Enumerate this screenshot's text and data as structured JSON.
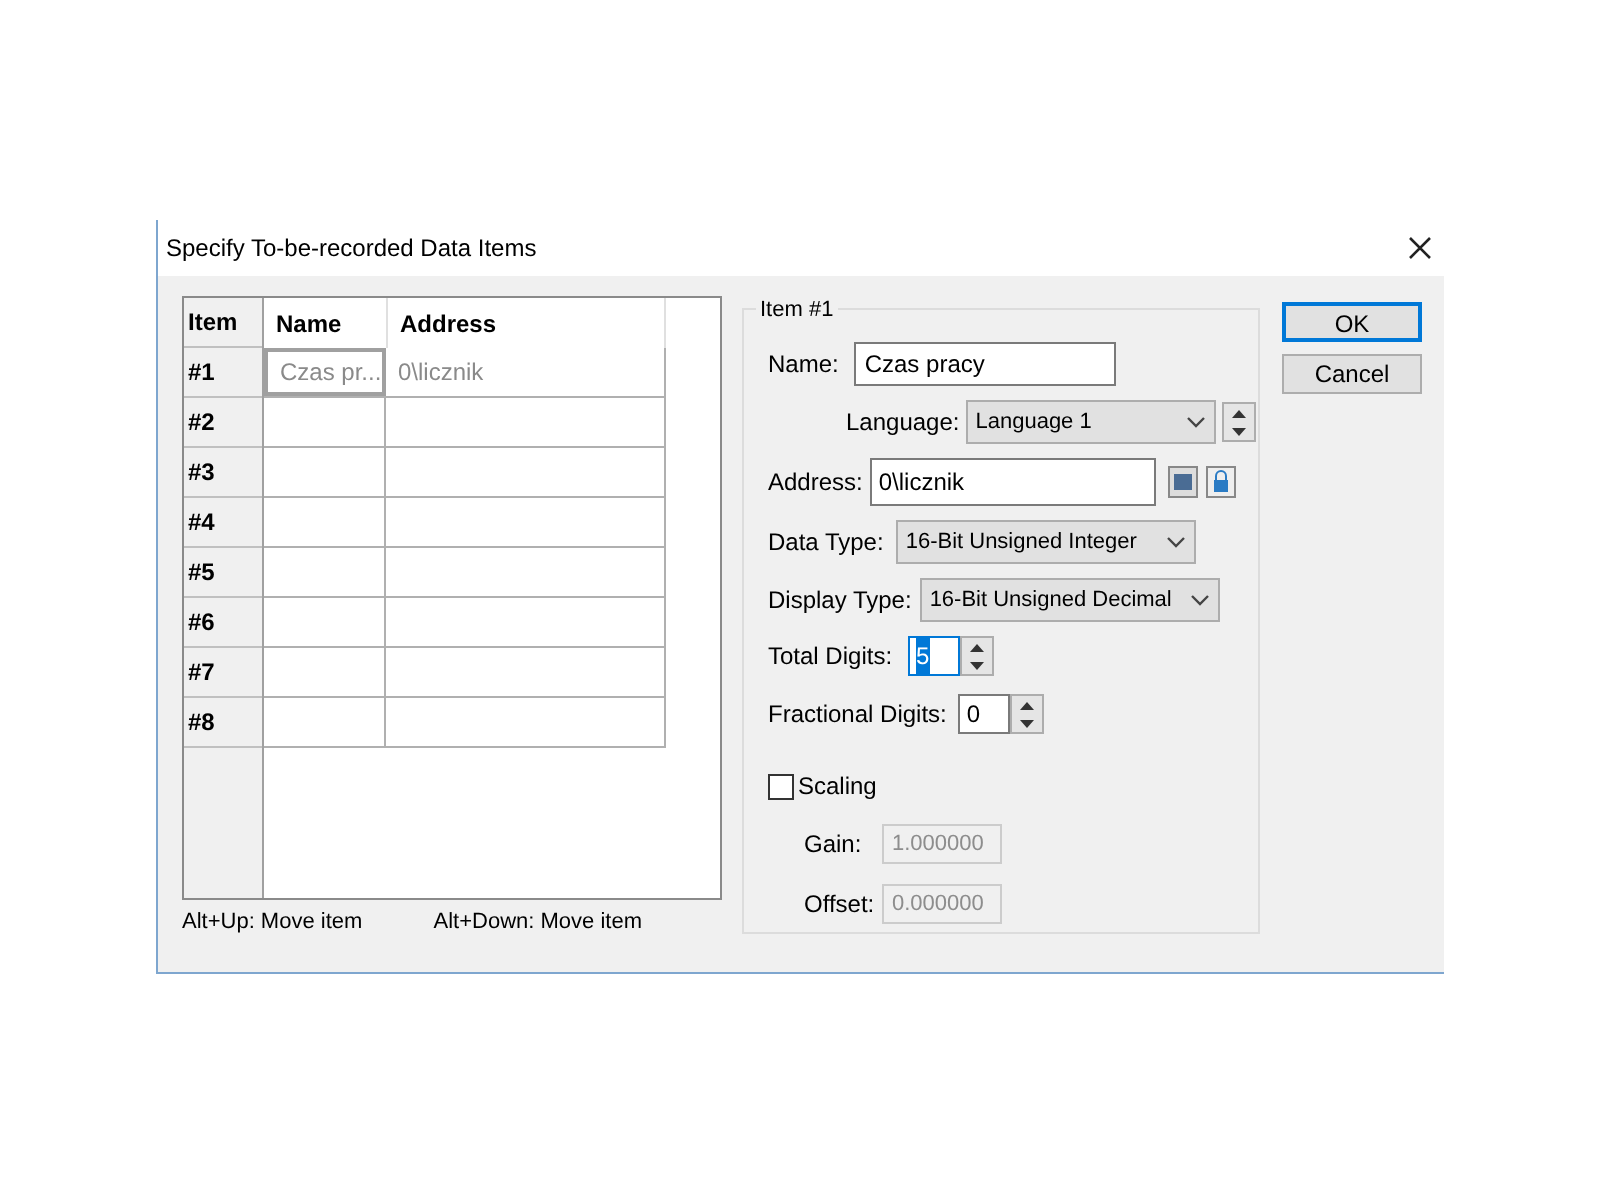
{
  "window": {
    "title": "Specify To-be-recorded Data Items"
  },
  "table": {
    "columns": [
      "Item",
      "Name",
      "Address"
    ],
    "rows": [
      {
        "item": "#1",
        "name": "Czas pr...",
        "address": "0\\licznik",
        "editing": true
      },
      {
        "item": "#2",
        "editing": false
      },
      {
        "item": "#3",
        "editing": false
      },
      {
        "item": "#4",
        "editing": false
      },
      {
        "item": "#5",
        "editing": false
      },
      {
        "item": "#6",
        "editing": false
      },
      {
        "item": "#7",
        "editing": false
      },
      {
        "item": "#8",
        "editing": false
      }
    ]
  },
  "hints": [
    "Alt+Up: Move item",
    "Alt+Down: Move item"
  ],
  "item_group": {
    "title": "Item #1",
    "name": {
      "label": "Name:",
      "value": "Czas pracy"
    },
    "language": {
      "label": "Language:",
      "value": "Language 1"
    },
    "address": {
      "label": "Address:",
      "value": "0\\licznik"
    },
    "data_type": {
      "label": "Data Type:",
      "value": "16-Bit Unsigned Integer"
    },
    "display_type": {
      "label": "Display Type:",
      "value": "16-Bit Unsigned Decimal"
    },
    "total_digits": {
      "label": "Total Digits:",
      "value": "5",
      "focused": true
    },
    "fractional_digits": {
      "label": "Fractional Digits:",
      "value": "0",
      "focused": false
    },
    "scaling": {
      "label": "Scaling",
      "checked": false
    },
    "gain": {
      "label": "Gain:",
      "value": "1.000000",
      "disabled": true
    },
    "offset": {
      "label": "Offset:",
      "value": "0.000000",
      "disabled": true
    }
  },
  "buttons": [
    {
      "label": "OK",
      "default": true
    },
    {
      "label": "Cancel",
      "default": false
    }
  ]
}
